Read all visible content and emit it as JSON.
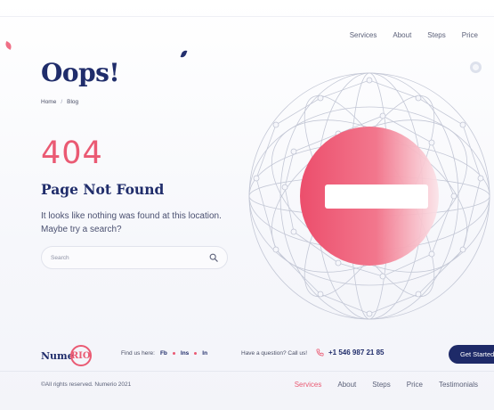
{
  "header": {
    "nav": [
      "Services",
      "About",
      "Steps",
      "Price"
    ]
  },
  "hero": {
    "title": "Oops!",
    "breadcrumb": [
      "Home",
      "Blog"
    ],
    "breadcrumb_separator": "/",
    "code": "404",
    "heading": "Page Not Found",
    "message": "It looks like nothing was found at this location. Maybe try a search?"
  },
  "search": {
    "placeholder": "Search",
    "value": ""
  },
  "footer": {
    "logo_text": "Nume",
    "logo_badge": "RIO",
    "find_label": "Find us here:",
    "socials": [
      "Fb",
      "Ins",
      "In"
    ],
    "question": "Have a question? Call us!",
    "phone": "+1 546 987 21 85",
    "cta": "Get Started",
    "copyright": "©All rights reserved. Numerio 2021",
    "nav": [
      "Services",
      "About",
      "Steps",
      "Price",
      "Testimonials"
    ],
    "active_nav": "Services"
  },
  "colors": {
    "primary": "#202d6b",
    "accent": "#ea5a73"
  },
  "icons": {
    "search": "search-icon",
    "phone": "phone-icon"
  }
}
